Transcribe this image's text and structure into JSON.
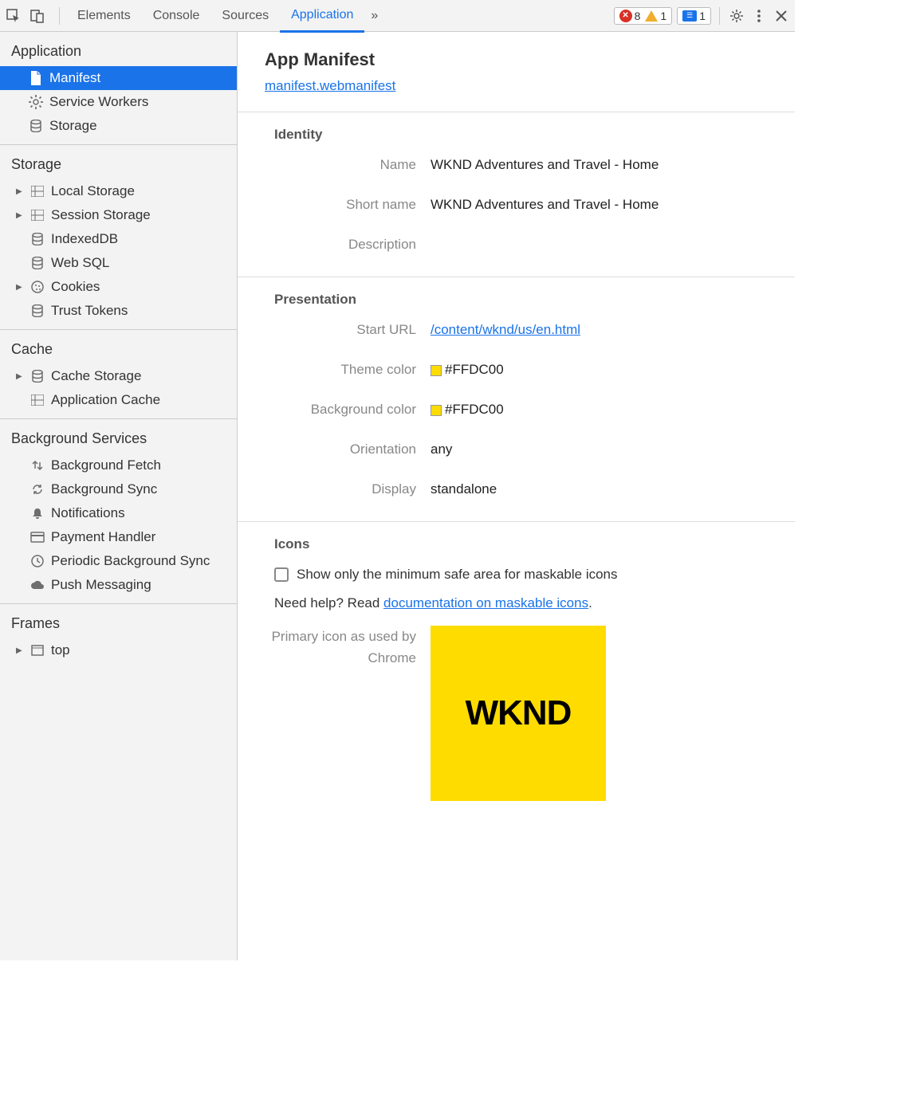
{
  "toolbar": {
    "tabs": [
      "Elements",
      "Console",
      "Sources",
      "Application"
    ],
    "activeTab": "Application",
    "overflow": "»",
    "errors": "8",
    "warnings": "1",
    "messages": "1"
  },
  "sidebar": {
    "sections": [
      {
        "title": "Application",
        "items": [
          {
            "label": "Manifest",
            "icon": "document",
            "selected": true,
            "arrow": false
          },
          {
            "label": "Service Workers",
            "icon": "gear",
            "arrow": false
          },
          {
            "label": "Storage",
            "icon": "db",
            "arrow": false
          }
        ]
      },
      {
        "title": "Storage",
        "items": [
          {
            "label": "Local Storage",
            "icon": "grid",
            "arrow": true
          },
          {
            "label": "Session Storage",
            "icon": "grid",
            "arrow": true
          },
          {
            "label": "IndexedDB",
            "icon": "db",
            "arrow": false
          },
          {
            "label": "Web SQL",
            "icon": "db",
            "arrow": false
          },
          {
            "label": "Cookies",
            "icon": "cookie",
            "arrow": true
          },
          {
            "label": "Trust Tokens",
            "icon": "db",
            "arrow": false
          }
        ]
      },
      {
        "title": "Cache",
        "items": [
          {
            "label": "Cache Storage",
            "icon": "db",
            "arrow": true
          },
          {
            "label": "Application Cache",
            "icon": "grid",
            "arrow": false
          }
        ]
      },
      {
        "title": "Background Services",
        "items": [
          {
            "label": "Background Fetch",
            "icon": "updown",
            "arrow": false
          },
          {
            "label": "Background Sync",
            "icon": "sync",
            "arrow": false
          },
          {
            "label": "Notifications",
            "icon": "bell",
            "arrow": false
          },
          {
            "label": "Payment Handler",
            "icon": "card",
            "arrow": false
          },
          {
            "label": "Periodic Background Sync",
            "icon": "clock",
            "arrow": false
          },
          {
            "label": "Push Messaging",
            "icon": "cloud",
            "arrow": false
          }
        ]
      },
      {
        "title": "Frames",
        "items": [
          {
            "label": "top",
            "icon": "frame",
            "arrow": true
          }
        ]
      }
    ]
  },
  "content": {
    "heading": "App Manifest",
    "manifestLink": "manifest.webmanifest",
    "identity": {
      "title": "Identity",
      "name_label": "Name",
      "name_value": "WKND Adventures and Travel - Home",
      "shortname_label": "Short name",
      "shortname_value": "WKND Adventures and Travel - Home",
      "description_label": "Description",
      "description_value": ""
    },
    "presentation": {
      "title": "Presentation",
      "starturl_label": "Start URL",
      "starturl_value": "/content/wknd/us/en.html",
      "themecolor_label": "Theme color",
      "themecolor_value": "#FFDC00",
      "bgcolor_label": "Background color",
      "bgcolor_value": "#FFDC00",
      "orientation_label": "Orientation",
      "orientation_value": "any",
      "display_label": "Display",
      "display_value": "standalone"
    },
    "icons": {
      "title": "Icons",
      "checkbox_label": "Show only the minimum safe area for maskable icons",
      "help_prefix": "Need help? Read ",
      "help_link": "documentation on maskable icons",
      "help_suffix": ".",
      "primary_label": "Primary icon as used by Chrome",
      "icon_text": "WKND",
      "icon_bg": "#FFDC00"
    }
  }
}
